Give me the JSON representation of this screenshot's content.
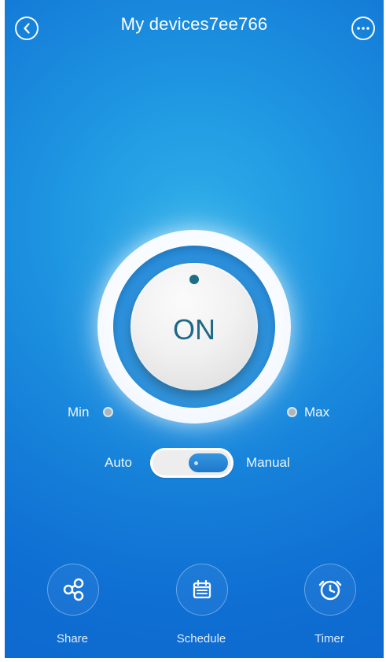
{
  "header": {
    "title": "My devices7ee766",
    "back_icon": "chevron-left-icon",
    "more_icon": "ellipsis-icon"
  },
  "control": {
    "power_state_label": "ON",
    "indicator_icon": "indicator-dot-icon",
    "min_label": "Min",
    "max_label": "Max",
    "mode_left_label": "Auto",
    "mode_right_label": "Manual",
    "mode_selected": "Manual"
  },
  "actions": [
    {
      "label": "Share",
      "icon": "share-icon"
    },
    {
      "label": "Schedule",
      "icon": "calendar-icon"
    },
    {
      "label": "Timer",
      "icon": "alarm-clock-icon"
    }
  ],
  "colors": {
    "background_top": "#157ed8",
    "background_center": "#2faee9",
    "accent_blue": "#1d77cc",
    "button_text": "#1f6987",
    "white": "#ffffff"
  }
}
